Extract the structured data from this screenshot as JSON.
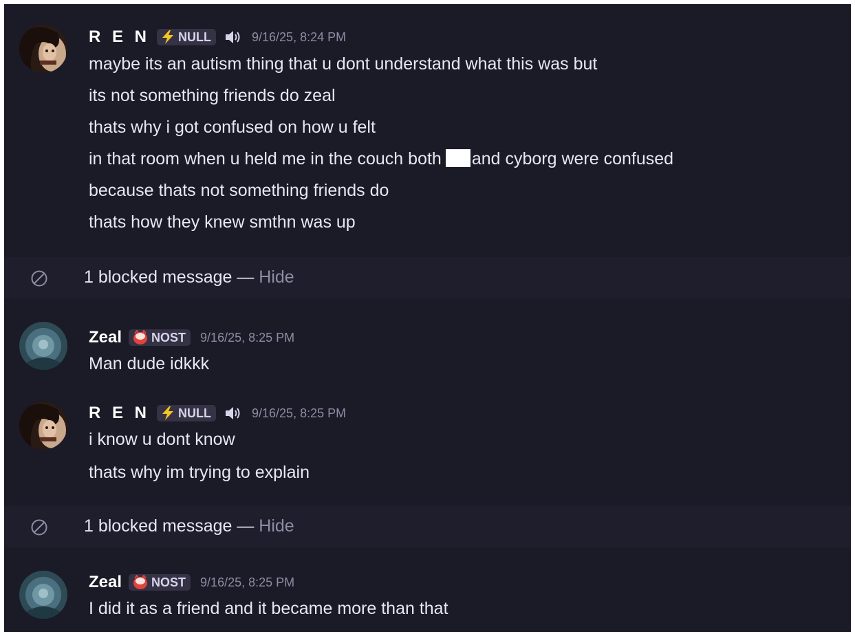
{
  "messages": [
    {
      "username": "R E N",
      "tag": "NULL",
      "tag_icon": "lightning-icon",
      "has_speaker": true,
      "timestamp": "9/16/25, 8:24 PM",
      "lines": [
        "maybe its an autism thing that u dont understand what this was but",
        "its not something friends do zeal",
        "thats why i got confused on how u felt",
        "in that room when u held me in the couch both",
        "because thats not something friends do",
        "thats how they knew smthn was up"
      ],
      "line4_tail": "and cyborg were confused"
    },
    {
      "username": "Zeal",
      "tag": "NOST",
      "tag_icon": "red-creature-icon",
      "timestamp": "9/16/25, 8:25 PM",
      "lines": [
        "Man dude idkkk"
      ]
    },
    {
      "username": "R E N",
      "tag": "NULL",
      "tag_icon": "lightning-icon",
      "has_speaker": true,
      "timestamp": "9/16/25, 8:25 PM",
      "lines": [
        "i know u dont know",
        "thats why im trying to explain"
      ]
    },
    {
      "username": "Zeal",
      "tag": "NOST",
      "tag_icon": "red-creature-icon",
      "timestamp": "9/16/25, 8:25 PM",
      "lines": [
        "I did it as a friend and it became more than that"
      ]
    }
  ],
  "blocked": [
    {
      "text": "1 blocked message — ",
      "action": "Hide"
    },
    {
      "text": "1 blocked message — ",
      "action": "Hide"
    }
  ],
  "colors": {
    "background": "#1b1a27",
    "blocked_background": "#1f1e2c",
    "text": "#e8e6f2",
    "muted": "#8f8ca3",
    "tag_background": "#353245",
    "lightning": "#f5c61e",
    "creature": "#e0443a"
  }
}
